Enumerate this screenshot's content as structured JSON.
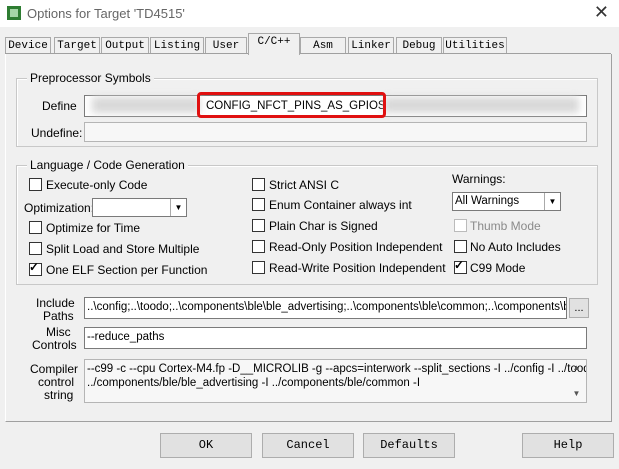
{
  "window": {
    "title": "Options for Target 'TD4515'",
    "close_icon": "close-icon"
  },
  "tabs": [
    "Device",
    "Target",
    "Output",
    "Listing",
    "User",
    "C/C++",
    "Asm",
    "Linker",
    "Debug",
    "Utilities"
  ],
  "active_tab": "C/C++",
  "preprocessor": {
    "legend": "Preprocessor Symbols",
    "define_label": "Define",
    "define_value": "CONFIG_NFCT_PINS_AS_GPIOS",
    "undefine_label": "Undefine:",
    "undefine_value": ""
  },
  "language": {
    "legend": "Language / Code Generation",
    "execute_only": "Execute-only Code",
    "optimization_label": "Optimization:",
    "optimization_value": "",
    "optimize_time": "Optimize for Time",
    "split_load": "Split Load and Store Multiple",
    "one_elf": "One ELF Section per Function",
    "strict_ansi": "Strict ANSI C",
    "enum_container": "Enum Container always int",
    "plain_char": "Plain Char is Signed",
    "ro_pi": "Read-Only Position Independent",
    "rw_pi": "Read-Write Position Independent",
    "warnings_label": "Warnings:",
    "warnings_value": "All Warnings",
    "thumb_mode": "Thumb Mode",
    "no_auto_includes": "No Auto Includes",
    "c99_mode": "C99 Mode"
  },
  "include_paths": {
    "label_line1": "Include",
    "label_line2": "Paths",
    "value": "..\\config;..\\toodo;..\\components\\ble\\ble_advertising;..\\components\\ble\\common;..\\components\\ble\\",
    "browse": "..."
  },
  "misc": {
    "label_line1": "Misc",
    "label_line2": "Controls",
    "value": "--reduce_paths"
  },
  "compiler": {
    "label_line1": "Compiler",
    "label_line2": "control",
    "label_line3": "string",
    "line1": "--c99 -c --cpu Cortex-M4.fp -D__MICROLIB -g --apcs=interwork --split_sections -I ../config -I ../toodo -I",
    "line2": "../components/ble/ble_advertising -I ../components/ble/common -I"
  },
  "buttons": {
    "ok": "OK",
    "cancel": "Cancel",
    "defaults": "Defaults",
    "help": "Help"
  }
}
